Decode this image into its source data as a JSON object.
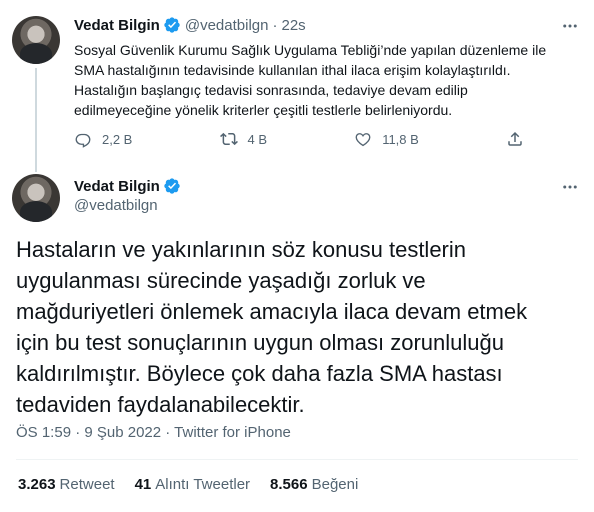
{
  "reply_tweet": {
    "author_name": "Vedat Bilgin",
    "author_handle": "@vedatbilgn",
    "separator": "·",
    "time": "22s",
    "lines": [
      "Sosyal Güvenlik Kurumu Sağlık Uygulama Tebliği’nde yapılan düzenleme ile",
      "SMA hastalığının tedavisinde kullanılan ithal ilaca erişim kolaylaştırıldı.",
      "Hastalığın başlangıç tedavisi sonrasında, tedaviye devam edilip",
      "edilmeyeceğine yönelik kriterler çeşitli testlerle belirleniyordu."
    ],
    "actions": {
      "reply_count": "2,2 B",
      "retweet_count": "4 B",
      "like_count": "11,8 B"
    }
  },
  "main_tweet": {
    "author_name": "Vedat Bilgin",
    "author_handle": "@vedatbilgn",
    "lines": [
      "Hastaların ve yakınlarının söz konusu testlerin",
      "uygulanması sürecinde yaşadığı zorluk ve",
      "mağduriyetleri önlemek amacıyla ilaca devam etmek",
      "için bu test sonuçlarının uygun olması zorunluluğu",
      "kaldırılmıştır. Böylece çok daha fazla SMA hastası",
      "tedaviden faydalanabilecektir."
    ],
    "timestamp": "ÖS 1:59 · 9 Şub 2022 · Twitter for iPhone",
    "stats": {
      "retweets_value": "3.263",
      "retweets_label": "Retweet",
      "quotes_value": "41",
      "quotes_label": "Alıntı Tweetler",
      "likes_value": "8.566",
      "likes_label": "Beğeni"
    }
  },
  "colors": {
    "text_primary": "#0f1419",
    "text_secondary": "#536471",
    "verified_blue": "#1d9bf0",
    "divider": "#eff3f4",
    "thread_line": "#cfd9de"
  },
  "icons": [
    "verified-badge-icon",
    "more-icon",
    "reply-icon",
    "retweet-icon",
    "like-icon",
    "share-icon"
  ]
}
